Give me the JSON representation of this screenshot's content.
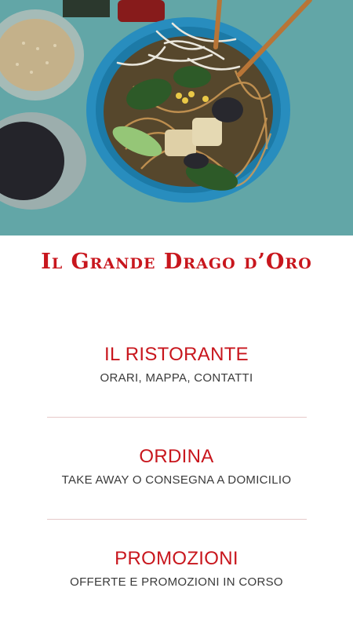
{
  "brand": {
    "title": "Il Grande Drago d’Oro"
  },
  "hero": {
    "alt": "Ramen bowl with noodles, bean sprouts, spinach and chopsticks"
  },
  "menu": [
    {
      "title": "IL RISTORANTE",
      "subtitle": "ORARI, MAPPA, CONTATTI"
    },
    {
      "title": "ORDINA",
      "subtitle": "TAKE AWAY O CONSEGNA A DOMICILIO"
    },
    {
      "title": "PROMOZIONI",
      "subtitle": "OFFERTE E PROMOZIONI IN CORSO"
    }
  ],
  "colors": {
    "accent": "#c8161d",
    "divider": "#e6c9c9",
    "subtitle": "#3a3a3a"
  }
}
